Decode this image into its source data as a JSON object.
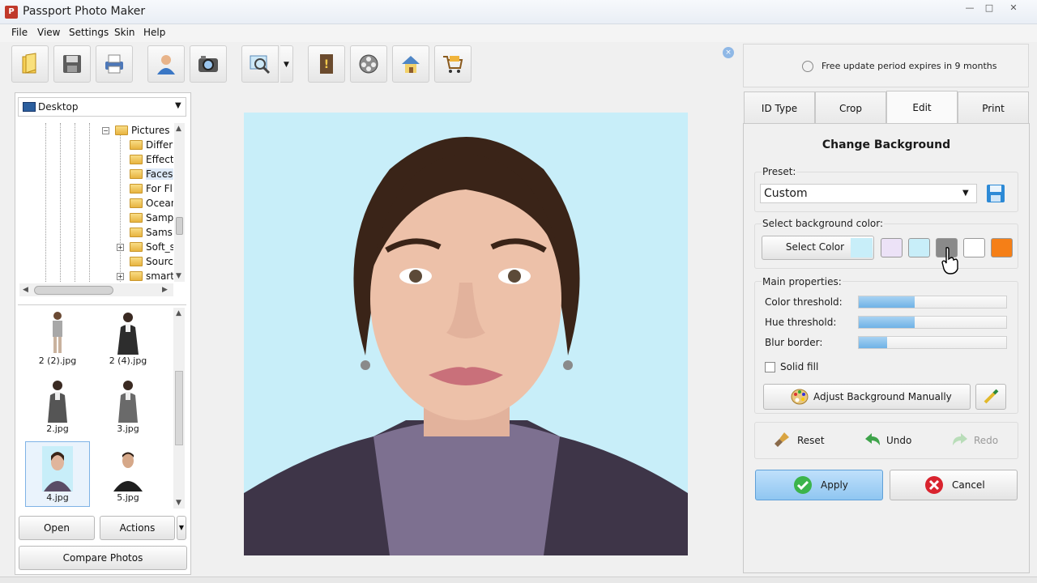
{
  "window": {
    "title": "Passport Photo Maker",
    "minimize": "—",
    "maximize": "□",
    "close": "✕"
  },
  "menu": [
    "File",
    "View",
    "Settings",
    "Skin",
    "Help"
  ],
  "toolbar": {
    "buttons": [
      "open-icon",
      "save-icon",
      "print-icon",
      "user-icon",
      "camera-icon",
      "zoom-icon",
      "help-book-icon",
      "film-reel-icon",
      "home-icon",
      "cart-icon"
    ],
    "close": "×"
  },
  "update": {
    "text": "Free update period expires in 9 months"
  },
  "browser": {
    "location": "Desktop",
    "tree": [
      {
        "label": "Pictures",
        "expanded": true
      },
      {
        "label": "Differ"
      },
      {
        "label": "Effect"
      },
      {
        "label": "Faces",
        "selected": true
      },
      {
        "label": "For Fl"
      },
      {
        "label": "Ocean"
      },
      {
        "label": "Samp"
      },
      {
        "label": "Sams"
      },
      {
        "label": "Soft_s",
        "expandable": true
      },
      {
        "label": "Sourc"
      },
      {
        "label": "smart",
        "expandable": true
      }
    ],
    "thumbnails": [
      "2 (2).jpg",
      "2 (4).jpg",
      "2.jpg",
      "3.jpg",
      "4.jpg",
      "5.jpg"
    ],
    "selected_thumbnail": "4.jpg",
    "open_label": "Open",
    "actions_label": "Actions",
    "compare_label": "Compare Photos"
  },
  "tabs": [
    "ID Type",
    "Crop",
    "Edit",
    "Print"
  ],
  "active_tab": "Edit",
  "edit": {
    "title": "Change Background",
    "preset_label": "Preset:",
    "preset_value": "Custom",
    "bg_color_label": "Select background color:",
    "select_color_label": "Select Color",
    "current_color": "#c8eef9",
    "swatches": [
      "#ece2f7",
      "#c8eef9",
      "#8a8a8a",
      "#ffffff",
      "#f57f17"
    ],
    "main_props_label": "Main properties:",
    "properties": [
      {
        "label": "Color threshold:",
        "value": 0.38
      },
      {
        "label": "Hue threshold:",
        "value": 0.38
      },
      {
        "label": "Blur border:",
        "value": 0.19
      }
    ],
    "solid_fill_label": "Solid fill",
    "solid_fill_checked": false,
    "adjust_label": "Adjust Background Manually",
    "reset_label": "Reset",
    "undo_label": "Undo",
    "redo_label": "Redo",
    "apply_label": "Apply",
    "cancel_label": "Cancel"
  }
}
